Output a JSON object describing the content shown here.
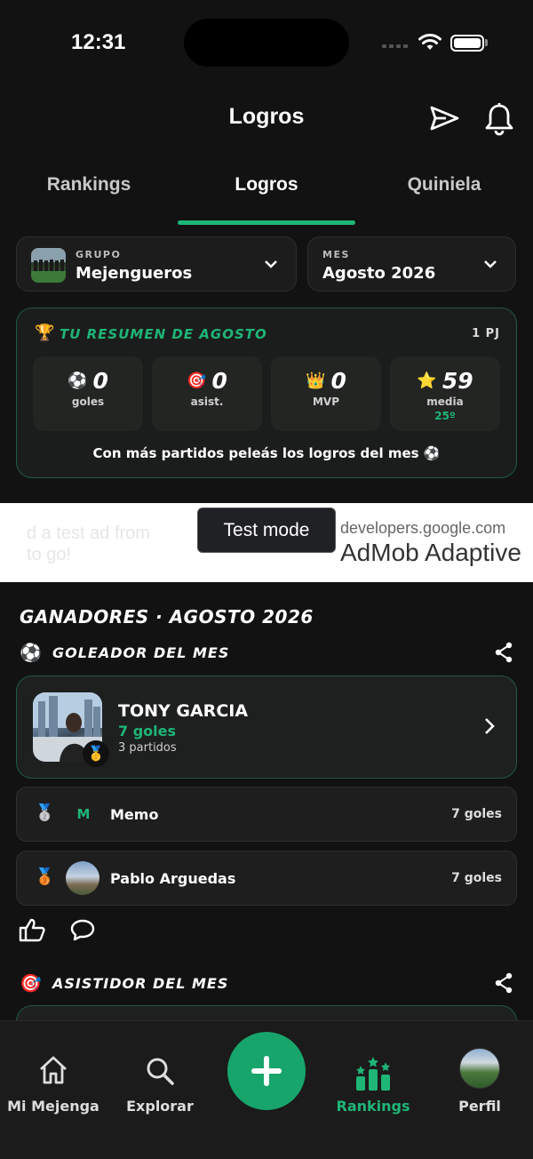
{
  "status_bar": {
    "time": "12:31"
  },
  "header": {
    "title": "Logros"
  },
  "tabs": [
    {
      "label": "Rankings"
    },
    {
      "label": "Logros"
    },
    {
      "label": "Quiniela"
    }
  ],
  "selectors": {
    "group": {
      "label": "GRUPO",
      "value": "Mejengueros"
    },
    "month": {
      "label": "MES",
      "value": "Agosto 2026"
    }
  },
  "summary": {
    "trophy_emoji": "🏆",
    "title": "TU RESUMEN DE AGOSTO",
    "pj": "1 PJ",
    "stats": [
      {
        "emoji": "⚽",
        "value": "0",
        "label": "goles"
      },
      {
        "emoji": "🎯",
        "value": "0",
        "label": "asist."
      },
      {
        "emoji": "👑",
        "value": "0",
        "label": "MVP"
      },
      {
        "emoji": "⭐",
        "value": "59",
        "label": "media",
        "rank": "25º"
      }
    ],
    "note": "Con más partidos peleás los logros del mes ⚽"
  },
  "ad": {
    "text_left_1": "d a test ad from",
    "text_left_2": "to go!",
    "domain": "developers.google.com",
    "title": "AdMob Adaptive",
    "test_mode": "Test mode"
  },
  "winners": {
    "title": "GANADORES · AGOSTO 2026",
    "categories": [
      {
        "emoji": "⚽",
        "title": "GOLEADOR DEL MES",
        "winner": {
          "name": "TONY GARCIA",
          "value": "7 goles",
          "matches": "3 partidos",
          "medal": "🥇"
        },
        "others": [
          {
            "medal": "🥈",
            "initial": "M",
            "name": "Memo",
            "value": "7 goles"
          },
          {
            "medal": "🥉",
            "name": "Pablo Arguedas",
            "value": "7 goles"
          }
        ]
      },
      {
        "emoji": "🎯",
        "title": "ASISTIDOR DEL MES"
      }
    ]
  },
  "bottom_nav": [
    {
      "label": "Mi Mejenga",
      "icon": "home-icon"
    },
    {
      "label": "Explorar",
      "icon": "search-icon"
    },
    {
      "label": "",
      "icon": "plus-icon"
    },
    {
      "label": "Rankings",
      "icon": "rankings-icon"
    },
    {
      "label": "Perfil",
      "icon": "profile-avatar"
    }
  ],
  "colors": {
    "accent": "#1fb577",
    "background": "#121212",
    "card": "#1e201f"
  }
}
